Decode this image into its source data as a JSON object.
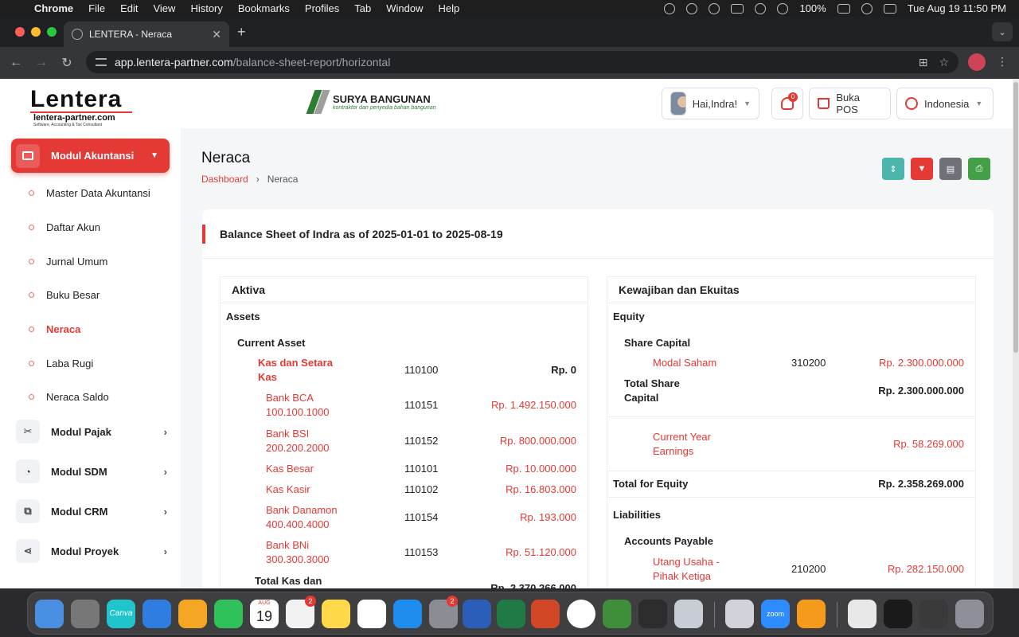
{
  "menubar": {
    "app": "Chrome",
    "items": [
      "File",
      "Edit",
      "View",
      "History",
      "Bookmarks",
      "Profiles",
      "Tab",
      "Window",
      "Help"
    ],
    "battery": "100%",
    "clock": "Tue Aug 19  11:50 PM"
  },
  "browser": {
    "tab_title": "LENTERA - Neraca",
    "url_host": "app.lentera-partner.com",
    "url_path": "/balance-sheet-report/horizontal"
  },
  "brand": {
    "logo": "Lentera",
    "site": "lentera-partner.com",
    "tagline": "Software, Accounting & Tax Consultant",
    "company_name": "SURYA BANGUNAN",
    "company_sub": "kontraktor dan penyedia bahan bangunan"
  },
  "header": {
    "greeting": "Hai,Indra!",
    "notif_count": "0",
    "pos_label": "Buka POS",
    "language": "Indonesia"
  },
  "sidebar": {
    "active_module": "Modul Akuntansi",
    "sub_items": [
      {
        "label": "Master Data Akuntansi"
      },
      {
        "label": "Daftar Akun"
      },
      {
        "label": "Jurnal Umum"
      },
      {
        "label": "Buku Besar"
      },
      {
        "label": "Neraca"
      },
      {
        "label": "Laba Rugi"
      },
      {
        "label": "Neraca Saldo"
      }
    ],
    "modules": [
      {
        "label": "Modul Pajak"
      },
      {
        "label": "Modul SDM"
      },
      {
        "label": "Modul CRM"
      },
      {
        "label": "Modul Proyek"
      }
    ]
  },
  "page": {
    "title": "Neraca",
    "breadcrumb_home": "Dashboard",
    "breadcrumb_current": "Neraca",
    "report_title": "Balance Sheet of Indra as of 2025-01-01 to 2025-08-19"
  },
  "aktiva": {
    "title": "Aktiva",
    "group": "Assets",
    "subgroup": "Current Asset",
    "parent": {
      "name_line1": "Kas dan Setara",
      "name_line2": "Kas",
      "code": "110100",
      "value": "Rp. 0"
    },
    "accounts": [
      {
        "line1": "Bank BCA",
        "line2": "100.100.1000",
        "code": "110151",
        "value": "Rp. 1.492.150.000"
      },
      {
        "line1": "Bank BSI",
        "line2": "200.200.2000",
        "code": "110152",
        "value": "Rp. 800.000.000"
      },
      {
        "line1": "Kas Besar",
        "line2": "",
        "code": "110101",
        "value": "Rp. 10.000.000"
      },
      {
        "line1": "Kas Kasir",
        "line2": "",
        "code": "110102",
        "value": "Rp. 16.803.000"
      },
      {
        "line1": "Bank Danamon",
        "line2": "400.400.4000",
        "code": "110154",
        "value": "Rp. 193.000"
      },
      {
        "line1": "Bank BNi",
        "line2": "300.300.3000",
        "code": "110153",
        "value": "Rp. 51.120.000"
      }
    ],
    "total_label": "Total Kas dan",
    "total_value": "Rp. 2.370.266.000"
  },
  "kewajiban": {
    "title": "Kewajiban dan Ekuitas",
    "equity_group": "Equity",
    "share_capital": "Share Capital",
    "modal": {
      "name": "Modal Saham",
      "code": "310200",
      "value": "Rp. 2.300.000.000"
    },
    "total_share_line1": "Total Share",
    "total_share_line2": "Capital",
    "total_share_value": "Rp. 2.300.000.000",
    "cye_line1": "Current Year",
    "cye_line2": "Earnings",
    "cye_value": "Rp. 58.269.000",
    "total_equity_label": "Total for Equity",
    "total_equity_value": "Rp. 2.358.269.000",
    "liabilities_group": "Liabilities",
    "ap_group": "Accounts Payable",
    "utang": {
      "line1": "Utang Usaha -",
      "line2": "Pihak Ketiga",
      "code": "210200",
      "value": "Rp. 282.150.000"
    }
  },
  "dock": {
    "calendar_month": "AUG",
    "calendar_day": "19",
    "reminders_badge": "2",
    "settings_badge": "2",
    "canva": "Canva",
    "zoom": "zoom"
  },
  "colors": {
    "accent": "#e53935",
    "teal": "#4db6ac",
    "gray": "#6e7178",
    "green": "#43a047"
  }
}
